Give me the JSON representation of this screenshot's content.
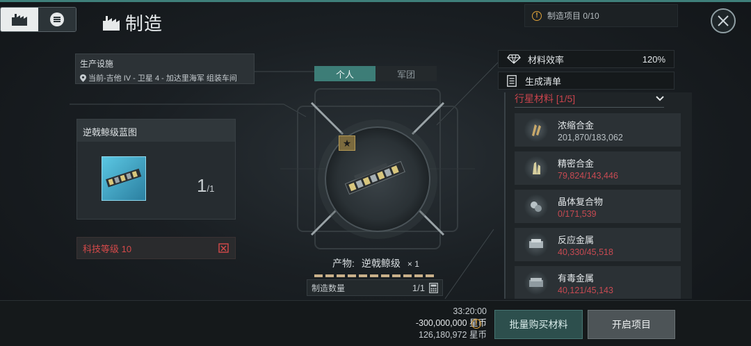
{
  "header": {
    "title": "制造",
    "project_count": "制造项目 0/10"
  },
  "facility": {
    "label": "生产设施",
    "location": "当前-吉他 IV - 卫星 4 - 加达里海军 组装车间"
  },
  "blueprint": {
    "title": "逆戟鲸级蓝图",
    "quantity": "1",
    "quantity_total": "/1"
  },
  "tech_level": "科技等级 10",
  "tabs": [
    {
      "label": "个人"
    },
    {
      "label": "军团"
    }
  ],
  "product": {
    "label": "产物:",
    "name": "逆戟鲸级",
    "quantity": "× 1"
  },
  "manufacture_quantity": {
    "label": "制造数量",
    "value": "1/1"
  },
  "material_efficiency": {
    "label": "材料效率",
    "value": "120%"
  },
  "generation_list": {
    "label": "生成清单"
  },
  "materials": {
    "header": "行星材料 [1/5]",
    "items": [
      {
        "name": "浓缩合金",
        "amount": "201,870/183,062",
        "status": "ok"
      },
      {
        "name": "精密合金",
        "amount": "79,824/143,446",
        "status": "short"
      },
      {
        "name": "晶体复合物",
        "amount": "0/171,539",
        "status": "short"
      },
      {
        "name": "反应金属",
        "amount": "40,330/45,518",
        "status": "short"
      },
      {
        "name": "有毒金属",
        "amount": "40,121/45,143",
        "status": "short"
      }
    ]
  },
  "footer": {
    "time": "33:20:00",
    "cost": "-300,000,000 星币",
    "balance": "126,180,972 星币",
    "buy_materials_label": "批量购买材料",
    "start_label": "开启项目"
  },
  "colors": {
    "accent": "#3d7d77",
    "warning": "#e0a43a",
    "shortage": "#c74a52"
  }
}
